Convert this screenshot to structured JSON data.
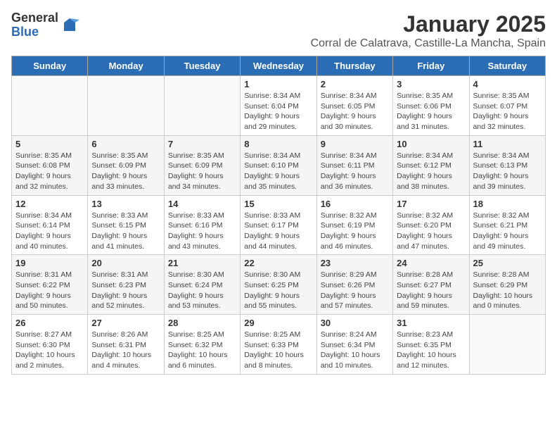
{
  "header": {
    "logo_general": "General",
    "logo_blue": "Blue",
    "title": "January 2025",
    "subtitle": "Corral de Calatrava, Castille-La Mancha, Spain"
  },
  "days_of_week": [
    "Sunday",
    "Monday",
    "Tuesday",
    "Wednesday",
    "Thursday",
    "Friday",
    "Saturday"
  ],
  "weeks": [
    [
      {
        "day": "",
        "content": ""
      },
      {
        "day": "",
        "content": ""
      },
      {
        "day": "",
        "content": ""
      },
      {
        "day": "1",
        "content": "Sunrise: 8:34 AM\nSunset: 6:04 PM\nDaylight: 9 hours and 29 minutes."
      },
      {
        "day": "2",
        "content": "Sunrise: 8:34 AM\nSunset: 6:05 PM\nDaylight: 9 hours and 30 minutes."
      },
      {
        "day": "3",
        "content": "Sunrise: 8:35 AM\nSunset: 6:06 PM\nDaylight: 9 hours and 31 minutes."
      },
      {
        "day": "4",
        "content": "Sunrise: 8:35 AM\nSunset: 6:07 PM\nDaylight: 9 hours and 32 minutes."
      }
    ],
    [
      {
        "day": "5",
        "content": "Sunrise: 8:35 AM\nSunset: 6:08 PM\nDaylight: 9 hours and 32 minutes."
      },
      {
        "day": "6",
        "content": "Sunrise: 8:35 AM\nSunset: 6:09 PM\nDaylight: 9 hours and 33 minutes."
      },
      {
        "day": "7",
        "content": "Sunrise: 8:35 AM\nSunset: 6:09 PM\nDaylight: 9 hours and 34 minutes."
      },
      {
        "day": "8",
        "content": "Sunrise: 8:34 AM\nSunset: 6:10 PM\nDaylight: 9 hours and 35 minutes."
      },
      {
        "day": "9",
        "content": "Sunrise: 8:34 AM\nSunset: 6:11 PM\nDaylight: 9 hours and 36 minutes."
      },
      {
        "day": "10",
        "content": "Sunrise: 8:34 AM\nSunset: 6:12 PM\nDaylight: 9 hours and 38 minutes."
      },
      {
        "day": "11",
        "content": "Sunrise: 8:34 AM\nSunset: 6:13 PM\nDaylight: 9 hours and 39 minutes."
      }
    ],
    [
      {
        "day": "12",
        "content": "Sunrise: 8:34 AM\nSunset: 6:14 PM\nDaylight: 9 hours and 40 minutes."
      },
      {
        "day": "13",
        "content": "Sunrise: 8:33 AM\nSunset: 6:15 PM\nDaylight: 9 hours and 41 minutes."
      },
      {
        "day": "14",
        "content": "Sunrise: 8:33 AM\nSunset: 6:16 PM\nDaylight: 9 hours and 43 minutes."
      },
      {
        "day": "15",
        "content": "Sunrise: 8:33 AM\nSunset: 6:17 PM\nDaylight: 9 hours and 44 minutes."
      },
      {
        "day": "16",
        "content": "Sunrise: 8:32 AM\nSunset: 6:19 PM\nDaylight: 9 hours and 46 minutes."
      },
      {
        "day": "17",
        "content": "Sunrise: 8:32 AM\nSunset: 6:20 PM\nDaylight: 9 hours and 47 minutes."
      },
      {
        "day": "18",
        "content": "Sunrise: 8:32 AM\nSunset: 6:21 PM\nDaylight: 9 hours and 49 minutes."
      }
    ],
    [
      {
        "day": "19",
        "content": "Sunrise: 8:31 AM\nSunset: 6:22 PM\nDaylight: 9 hours and 50 minutes."
      },
      {
        "day": "20",
        "content": "Sunrise: 8:31 AM\nSunset: 6:23 PM\nDaylight: 9 hours and 52 minutes."
      },
      {
        "day": "21",
        "content": "Sunrise: 8:30 AM\nSunset: 6:24 PM\nDaylight: 9 hours and 53 minutes."
      },
      {
        "day": "22",
        "content": "Sunrise: 8:30 AM\nSunset: 6:25 PM\nDaylight: 9 hours and 55 minutes."
      },
      {
        "day": "23",
        "content": "Sunrise: 8:29 AM\nSunset: 6:26 PM\nDaylight: 9 hours and 57 minutes."
      },
      {
        "day": "24",
        "content": "Sunrise: 8:28 AM\nSunset: 6:27 PM\nDaylight: 9 hours and 59 minutes."
      },
      {
        "day": "25",
        "content": "Sunrise: 8:28 AM\nSunset: 6:29 PM\nDaylight: 10 hours and 0 minutes."
      }
    ],
    [
      {
        "day": "26",
        "content": "Sunrise: 8:27 AM\nSunset: 6:30 PM\nDaylight: 10 hours and 2 minutes."
      },
      {
        "day": "27",
        "content": "Sunrise: 8:26 AM\nSunset: 6:31 PM\nDaylight: 10 hours and 4 minutes."
      },
      {
        "day": "28",
        "content": "Sunrise: 8:25 AM\nSunset: 6:32 PM\nDaylight: 10 hours and 6 minutes."
      },
      {
        "day": "29",
        "content": "Sunrise: 8:25 AM\nSunset: 6:33 PM\nDaylight: 10 hours and 8 minutes."
      },
      {
        "day": "30",
        "content": "Sunrise: 8:24 AM\nSunset: 6:34 PM\nDaylight: 10 hours and 10 minutes."
      },
      {
        "day": "31",
        "content": "Sunrise: 8:23 AM\nSunset: 6:35 PM\nDaylight: 10 hours and 12 minutes."
      },
      {
        "day": "",
        "content": ""
      }
    ]
  ]
}
